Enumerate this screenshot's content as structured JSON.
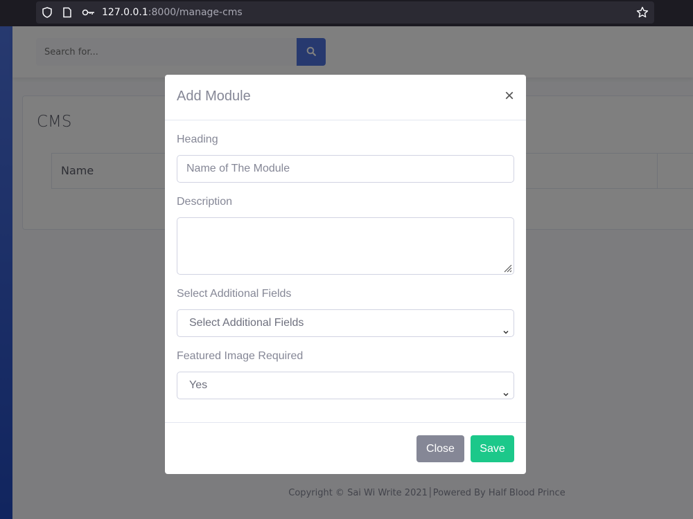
{
  "browser": {
    "url_host": "127.0.0.1",
    "url_rest": ":8000/manage-cms"
  },
  "topbar": {
    "search_placeholder": "Search for..."
  },
  "page": {
    "card_title": "CMS",
    "table_headers": [
      "Name"
    ]
  },
  "footer": {
    "text": "Copyright © Sai Wi Write 2021│Powered By Half Blood Prince"
  },
  "modal": {
    "title": "Add Module",
    "close_symbol": "×",
    "heading_label": "Heading",
    "heading_placeholder": "Name of The Module",
    "description_label": "Description",
    "fields_label": "Select Additional Fields",
    "fields_selected": "Select Additional Fields",
    "featured_label": "Featured Image Required",
    "featured_selected": "Yes",
    "close_button": "Close",
    "save_button": "Save"
  },
  "colors": {
    "primary": "#4e73df",
    "success": "#1cc88a",
    "secondary": "#858796"
  },
  "icons": [
    "shield-icon",
    "page-icon",
    "key-icon",
    "star-icon",
    "search-icon",
    "close-icon",
    "chevron-down-icon",
    "resize-grip-icon"
  ]
}
